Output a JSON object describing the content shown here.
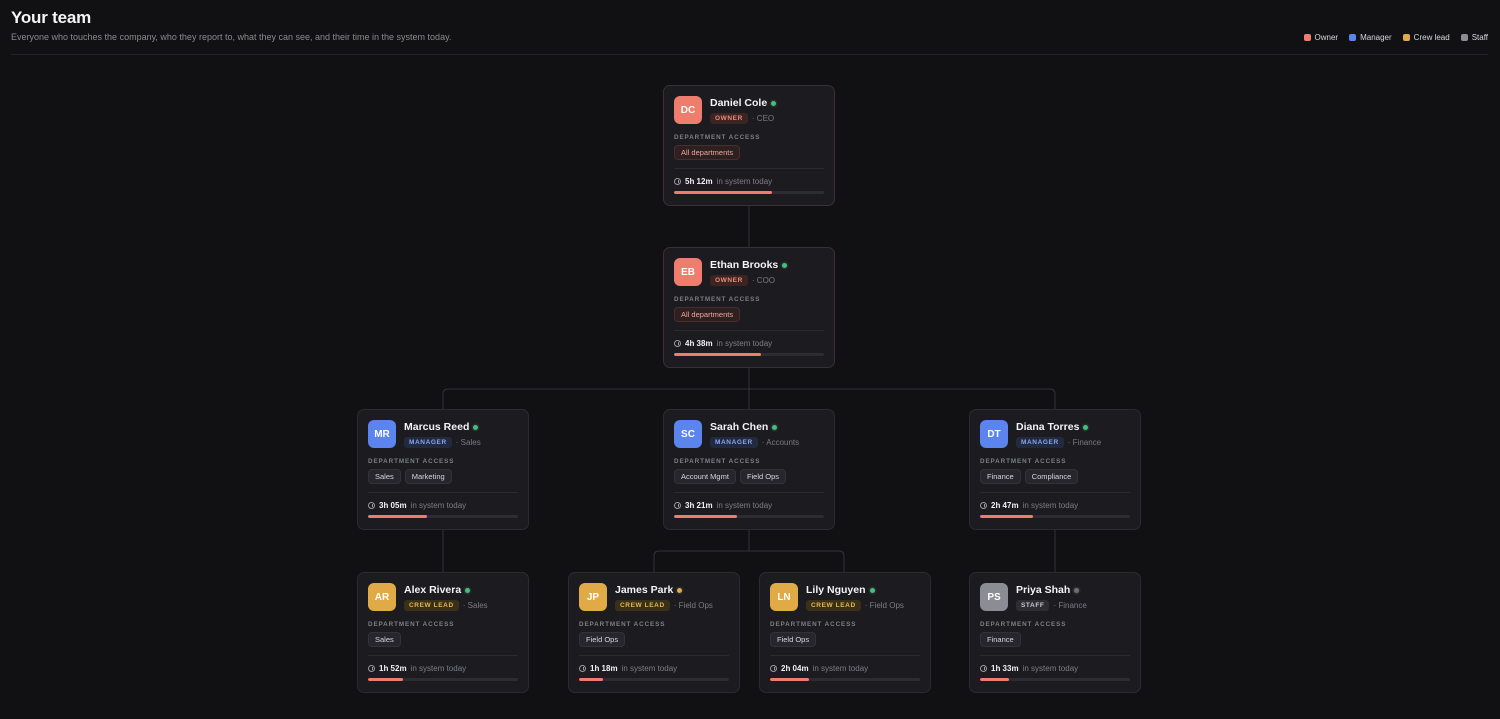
{
  "header": {
    "title": "Your team",
    "subtitle": "Everyone who touches the company, who they report to, what they can see, and their time in the system today."
  },
  "legend": [
    {
      "label": "Owner",
      "color": "#ee7d6d"
    },
    {
      "label": "Manager",
      "color": "#5b84ee"
    },
    {
      "label": "Crew lead",
      "color": "#e0aa46"
    },
    {
      "label": "Staff",
      "color": "#8c8c94"
    }
  ],
  "access_label": "DEPARTMENT ACCESS",
  "time_suffix": "in system today",
  "members": [
    {
      "initials": "DC",
      "name": "Daniel Cole",
      "badge": "OWNER",
      "role": "· CEO",
      "access": [
        "All departments"
      ],
      "time": "5h 12m",
      "progress": 0.65,
      "status": "online"
    },
    {
      "initials": "EB",
      "name": "Ethan Brooks",
      "badge": "OWNER",
      "role": "· COO",
      "access": [
        "All departments"
      ],
      "time": "4h 38m",
      "progress": 0.58,
      "status": "online"
    },
    {
      "initials": "MR",
      "name": "Marcus Reed",
      "badge": "MANAGER",
      "role": "· Sales",
      "access": [
        "Sales",
        "Marketing"
      ],
      "time": "3h 05m",
      "progress": 0.39,
      "status": "online"
    },
    {
      "initials": "SC",
      "name": "Sarah Chen",
      "badge": "MANAGER",
      "role": "· Accounts",
      "access": [
        "Account Mgmt",
        "Field Ops"
      ],
      "time": "3h 21m",
      "progress": 0.42,
      "status": "online"
    },
    {
      "initials": "DT",
      "name": "Diana Torres",
      "badge": "MANAGER",
      "role": "· Finance",
      "access": [
        "Finance",
        "Compliance"
      ],
      "time": "2h 47m",
      "progress": 0.35,
      "status": "online"
    },
    {
      "initials": "AR",
      "name": "Alex Rivera",
      "badge": "CREW LEAD",
      "role": "· Sales",
      "access": [
        "Sales"
      ],
      "time": "1h 52m",
      "progress": 0.23,
      "status": "online"
    },
    {
      "initials": "JP",
      "name": "James Park",
      "badge": "CREW LEAD",
      "role": "· Field Ops",
      "access": [
        "Field Ops"
      ],
      "time": "1h 18m",
      "progress": 0.16,
      "status": "away"
    },
    {
      "initials": "LN",
      "name": "Lily Nguyen",
      "badge": "CREW LEAD",
      "role": "· Field Ops",
      "access": [
        "Field Ops"
      ],
      "time": "2h 04m",
      "progress": 0.26,
      "status": "online"
    },
    {
      "initials": "PS",
      "name": "Priya Shah",
      "badge": "STAFF",
      "role": "· Finance",
      "access": [
        "Finance"
      ],
      "time": "1h 33m",
      "progress": 0.19,
      "status": "offline"
    }
  ]
}
